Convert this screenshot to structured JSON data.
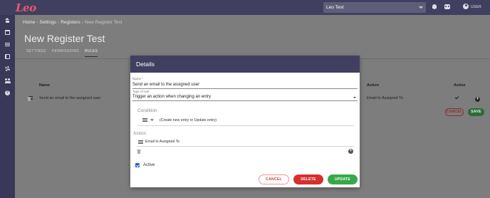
{
  "app": {
    "logo_text": "Leo",
    "workspace_select": "Leo Test",
    "user_label": "USER"
  },
  "sidebar": {
    "toggle_glyph": "›",
    "items": [
      {
        "icon": "home-icon"
      },
      {
        "icon": "calendar-icon"
      },
      {
        "icon": "list-icon"
      },
      {
        "icon": "book-icon"
      },
      {
        "icon": "gear-icon"
      },
      {
        "icon": "users-icon"
      },
      {
        "icon": "help-icon",
        "glyph": "?"
      }
    ]
  },
  "breadcrumb": {
    "items": [
      "Home",
      "Settings",
      "Registers"
    ],
    "separator": "›",
    "current": "New Register Test"
  },
  "page": {
    "title": "New Register Test"
  },
  "tabs": [
    {
      "label": "SETTINGS"
    },
    {
      "label": "PERMISSIONS"
    },
    {
      "label": "RULES",
      "active": true
    }
  ],
  "rules_table": {
    "columns": {
      "name": "Name",
      "action": "Action",
      "active": "Active"
    },
    "rows": [
      {
        "name": "Send an email to the assigned user",
        "action": "Email to Assigned To",
        "active": true
      }
    ],
    "add_glyph": "+"
  },
  "page_buttons": {
    "cancel": "CANCEL",
    "save": "SAVE"
  },
  "modal": {
    "title": "Details",
    "name_label": "Name *",
    "name_value": "Send an email to the assigned user",
    "type_label": "Type of rule",
    "type_value": "Trigger an action when changing an entry",
    "condition_label": "Condition",
    "condition_text": "(Create new entry or Update entry)",
    "action_label": "Action",
    "action_text": "Email to Assigned To",
    "add_glyph": "+",
    "active_label": "Active",
    "active_checked": true,
    "buttons": {
      "cancel": "CANCEL",
      "delete": "DELETE",
      "update": "UPDATE"
    }
  },
  "colors": {
    "header": "#413f60",
    "sidebar": "#3a3858",
    "delete": "#d62f2f",
    "update": "#37a84a",
    "checkbox": "#2d5fbf"
  }
}
